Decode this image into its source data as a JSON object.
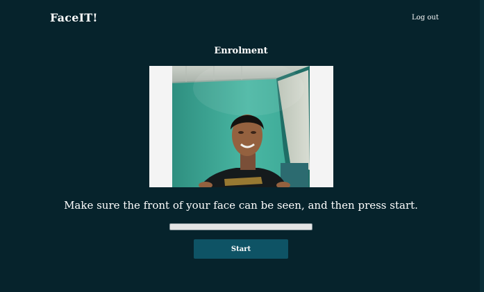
{
  "header": {
    "brand": "FaceIT!",
    "logout_label": "Log out"
  },
  "enrolment": {
    "title": "Enrolment",
    "instruction": "Make sure the front of your face can be seen, and then press start.",
    "progress_fraction": 0,
    "start_label": "Start"
  },
  "colors": {
    "background": "#06232c",
    "button": "#0e5365",
    "text": "#ffffff"
  }
}
